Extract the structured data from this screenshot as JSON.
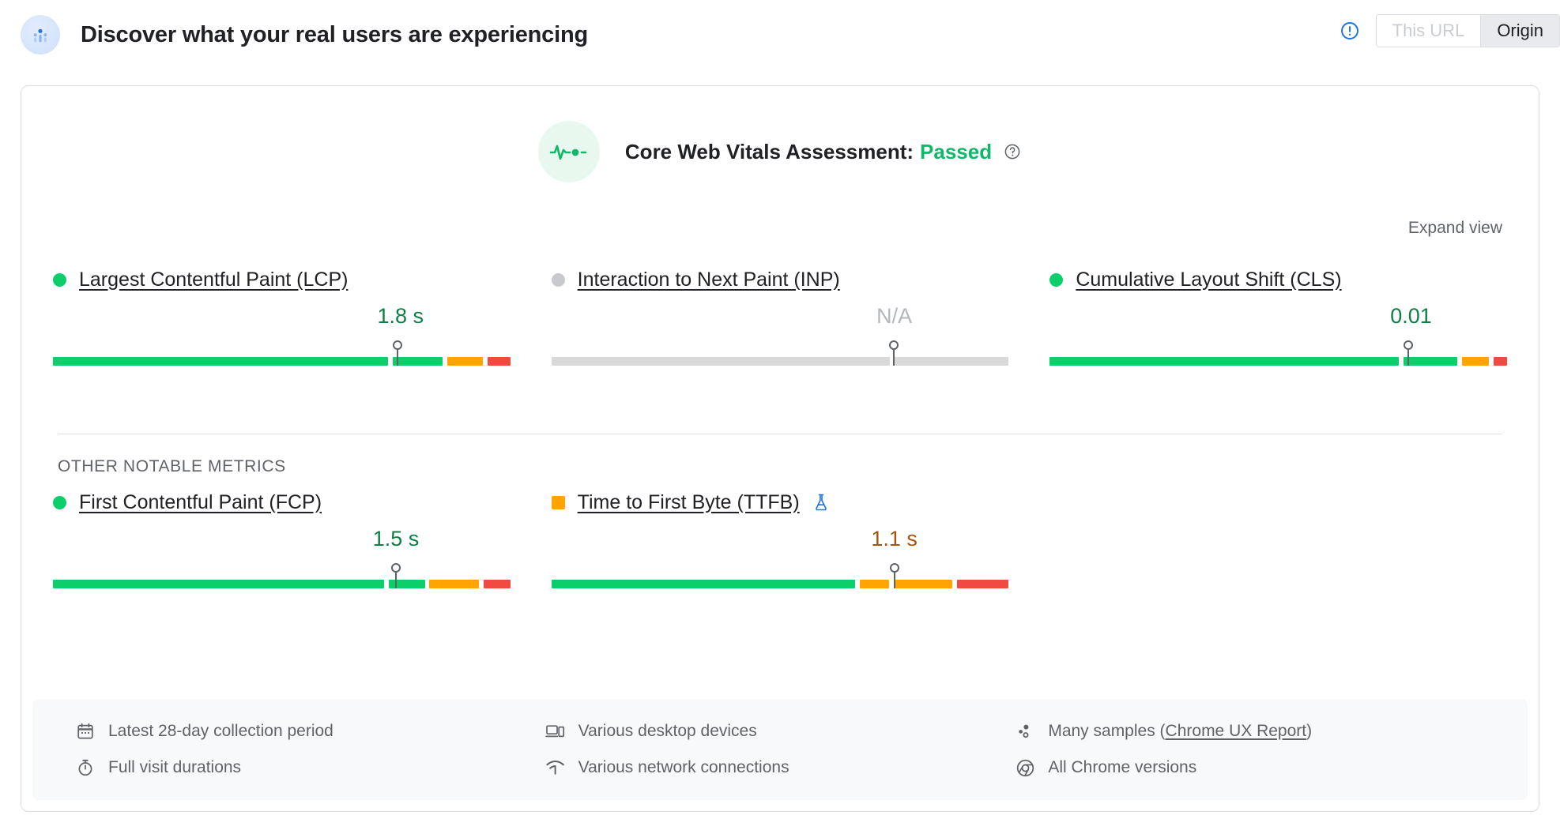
{
  "header": {
    "logo_icon": "crux-users-icon",
    "title": "Discover what your real users are experiencing",
    "info_icon": "info-circle-icon",
    "toggle": {
      "this_url_label": "This URL",
      "origin_label": "Origin",
      "selected": "Origin"
    }
  },
  "assessment": {
    "badge_icon": "pulse-heartbeat-icon",
    "label": "Core Web Vitals Assessment:",
    "status": "Passed",
    "help_icon": "help-circle-icon",
    "expand_view_label": "Expand view"
  },
  "other_metrics_label": "OTHER NOTABLE METRICS",
  "colors": {
    "good": "#0cce6b",
    "average": "#ffa400",
    "poor": "#f04a41",
    "na": "#d9d9d9",
    "good_text": "#0d7e45",
    "average_text": "#a9530a",
    "na_text": "#b4b7bb",
    "flask_blue": "#1a73e8"
  },
  "core_metrics": [
    {
      "name": "Largest Contentful Paint (LCP)",
      "short": "LCP",
      "status": "good",
      "marker_icon": "status-dot-good",
      "value": "1.8 s",
      "marker_percent": 76,
      "segments": [
        {
          "color": "good",
          "percent": 76
        },
        {
          "color": "good",
          "percent": 11
        },
        {
          "color": "average",
          "percent": 8
        },
        {
          "color": "poor",
          "percent": 5
        }
      ]
    },
    {
      "name": "Interaction to Next Paint (INP)",
      "short": "INP",
      "status": "na",
      "marker_icon": "status-dot-na",
      "value": "N/A",
      "marker_percent": 75,
      "segments": [
        {
          "color": "na",
          "percent": 75
        },
        {
          "color": "na",
          "percent": 25
        }
      ]
    },
    {
      "name": "Cumulative Layout Shift (CLS)",
      "short": "CLS",
      "status": "good",
      "marker_icon": "status-dot-good",
      "value": "0.01",
      "marker_percent": 79,
      "segments": [
        {
          "color": "good",
          "percent": 79
        },
        {
          "color": "good",
          "percent": 12
        },
        {
          "color": "average",
          "percent": 6
        },
        {
          "color": "poor",
          "percent": 3
        }
      ]
    }
  ],
  "other_notable_metrics": [
    {
      "name": "First Contentful Paint (FCP)",
      "short": "FCP",
      "status": "good",
      "marker_icon": "status-dot-good",
      "value": "1.5 s",
      "marker_percent": 75,
      "lab_icon": null,
      "segments": [
        {
          "color": "good",
          "percent": 75
        },
        {
          "color": "good",
          "percent": 8
        },
        {
          "color": "average",
          "percent": 11
        },
        {
          "color": "poor",
          "percent": 6
        }
      ]
    },
    {
      "name": "Time to First Byte (TTFB)",
      "short": "TTFB",
      "status": "average",
      "marker_icon": "status-square-average",
      "value": "1.1 s",
      "marker_percent": 75,
      "lab_icon": "flask-icon",
      "segments": [
        {
          "color": "good",
          "percent": 68
        },
        {
          "color": "average",
          "percent": 7
        },
        {
          "color": "average",
          "percent": 13
        },
        {
          "color": "poor",
          "percent": 12
        }
      ]
    }
  ],
  "footer": {
    "columns": [
      [
        {
          "icon": "calendar-icon",
          "text": "Latest 28-day collection period",
          "link": null
        },
        {
          "icon": "stopwatch-icon",
          "text": "Full visit durations",
          "link": null
        }
      ],
      [
        {
          "icon": "desktop-devices-icon",
          "text": "Various desktop devices",
          "link": null
        },
        {
          "icon": "network-signal-icon",
          "text": "Various network connections",
          "link": null
        }
      ],
      [
        {
          "icon": "samples-dots-icon",
          "text": "Many samples (",
          "link": "Chrome UX Report",
          "suffix": ")"
        },
        {
          "icon": "chrome-icon",
          "text": "All Chrome versions",
          "link": null
        }
      ]
    ]
  }
}
